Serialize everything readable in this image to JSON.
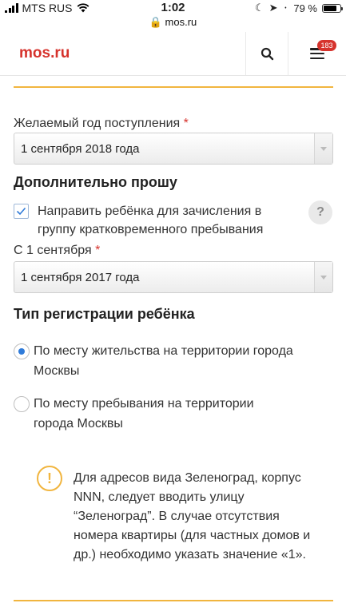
{
  "status_bar": {
    "carrier": "MTS RUS",
    "time": "1:02",
    "url": "mos.ru",
    "battery": "79 %",
    "battery_level": 0.79
  },
  "header": {
    "logo": "mos.ru",
    "menu_badge": "183"
  },
  "form": {
    "year_label": "Желаемый год поступления",
    "required_mark": "*",
    "year_value": "1 сентября 2018 года",
    "extra_title": "Дополнительно прошу",
    "extra_checkbox_label": "Направить ребёнка для зачисления в группу кратковременного пребывания",
    "extra_checked": true,
    "help_symbol": "?",
    "from_label": "С 1 сентября",
    "from_value": "1 сентября 2017 года",
    "registration_title": "Тип регистрации ребёнка",
    "registration_options": [
      {
        "label": "По месту жительства на территории города Москвы",
        "selected": true
      },
      {
        "label": "По месту пребывания на территории города Москвы",
        "selected": false
      }
    ],
    "note_symbol": "!",
    "note_text": "Для адресов вида Зеленоград, корпус NNN, следует вводить улицу “Зеленоград”. В случае отсутствия номера квартиры (для частных домов и др.) необходимо указать значение «1»."
  },
  "colors": {
    "brand_red": "#d6332d",
    "accent_orange": "#f1b53f",
    "radio_blue": "#2f7bd9"
  }
}
